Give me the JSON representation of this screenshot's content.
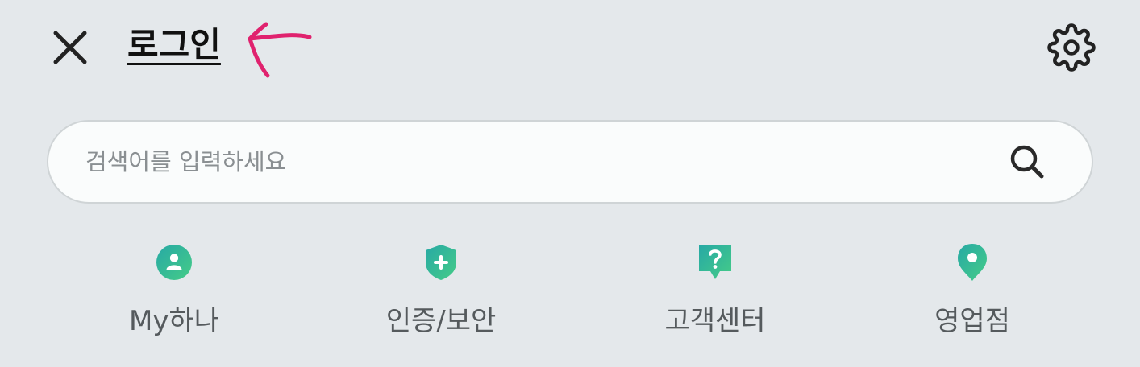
{
  "header": {
    "title": "로그인",
    "close_icon": "close-icon",
    "settings_icon": "gear-icon",
    "annotation_color": "#e0226e"
  },
  "search": {
    "placeholder": "검색어를 입력하세요",
    "value": "",
    "icon": "search-icon"
  },
  "quick_menu": {
    "accent_gradient": [
      "#2fb5a0",
      "#3ec98a"
    ],
    "items": [
      {
        "label": "My하나",
        "icon": "person-icon"
      },
      {
        "label": "인증/보안",
        "icon": "shield-plus-icon"
      },
      {
        "label": "고객센터",
        "icon": "question-bubble-icon"
      },
      {
        "label": "영업점",
        "icon": "location-pin-icon"
      }
    ]
  }
}
